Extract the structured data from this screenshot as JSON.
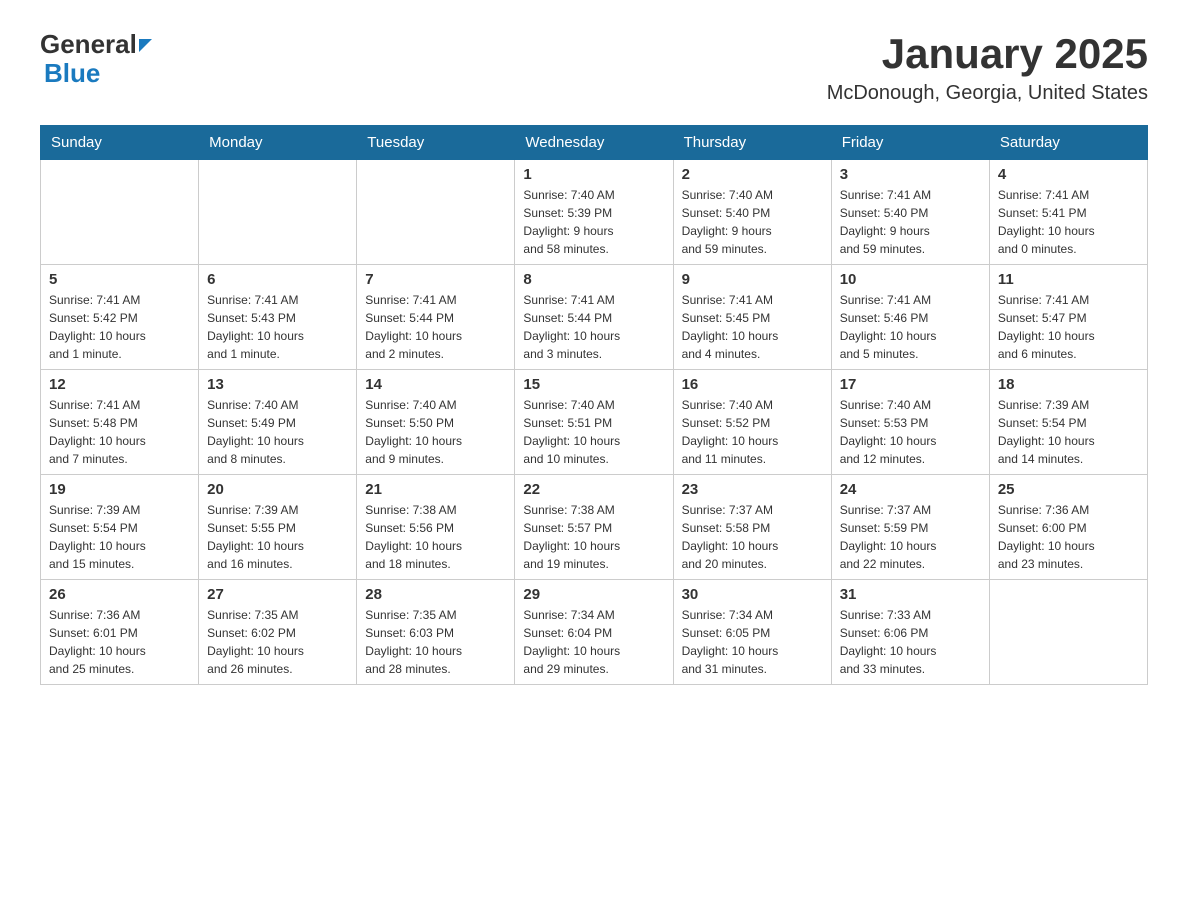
{
  "header": {
    "logo_general": "General",
    "logo_blue": "Blue",
    "month_year": "January 2025",
    "location": "McDonough, Georgia, United States"
  },
  "weekdays": [
    "Sunday",
    "Monday",
    "Tuesday",
    "Wednesday",
    "Thursday",
    "Friday",
    "Saturday"
  ],
  "weeks": [
    [
      {
        "day": "",
        "info": ""
      },
      {
        "day": "",
        "info": ""
      },
      {
        "day": "",
        "info": ""
      },
      {
        "day": "1",
        "info": "Sunrise: 7:40 AM\nSunset: 5:39 PM\nDaylight: 9 hours\nand 58 minutes."
      },
      {
        "day": "2",
        "info": "Sunrise: 7:40 AM\nSunset: 5:40 PM\nDaylight: 9 hours\nand 59 minutes."
      },
      {
        "day": "3",
        "info": "Sunrise: 7:41 AM\nSunset: 5:40 PM\nDaylight: 9 hours\nand 59 minutes."
      },
      {
        "day": "4",
        "info": "Sunrise: 7:41 AM\nSunset: 5:41 PM\nDaylight: 10 hours\nand 0 minutes."
      }
    ],
    [
      {
        "day": "5",
        "info": "Sunrise: 7:41 AM\nSunset: 5:42 PM\nDaylight: 10 hours\nand 1 minute."
      },
      {
        "day": "6",
        "info": "Sunrise: 7:41 AM\nSunset: 5:43 PM\nDaylight: 10 hours\nand 1 minute."
      },
      {
        "day": "7",
        "info": "Sunrise: 7:41 AM\nSunset: 5:44 PM\nDaylight: 10 hours\nand 2 minutes."
      },
      {
        "day": "8",
        "info": "Sunrise: 7:41 AM\nSunset: 5:44 PM\nDaylight: 10 hours\nand 3 minutes."
      },
      {
        "day": "9",
        "info": "Sunrise: 7:41 AM\nSunset: 5:45 PM\nDaylight: 10 hours\nand 4 minutes."
      },
      {
        "day": "10",
        "info": "Sunrise: 7:41 AM\nSunset: 5:46 PM\nDaylight: 10 hours\nand 5 minutes."
      },
      {
        "day": "11",
        "info": "Sunrise: 7:41 AM\nSunset: 5:47 PM\nDaylight: 10 hours\nand 6 minutes."
      }
    ],
    [
      {
        "day": "12",
        "info": "Sunrise: 7:41 AM\nSunset: 5:48 PM\nDaylight: 10 hours\nand 7 minutes."
      },
      {
        "day": "13",
        "info": "Sunrise: 7:40 AM\nSunset: 5:49 PM\nDaylight: 10 hours\nand 8 minutes."
      },
      {
        "day": "14",
        "info": "Sunrise: 7:40 AM\nSunset: 5:50 PM\nDaylight: 10 hours\nand 9 minutes."
      },
      {
        "day": "15",
        "info": "Sunrise: 7:40 AM\nSunset: 5:51 PM\nDaylight: 10 hours\nand 10 minutes."
      },
      {
        "day": "16",
        "info": "Sunrise: 7:40 AM\nSunset: 5:52 PM\nDaylight: 10 hours\nand 11 minutes."
      },
      {
        "day": "17",
        "info": "Sunrise: 7:40 AM\nSunset: 5:53 PM\nDaylight: 10 hours\nand 12 minutes."
      },
      {
        "day": "18",
        "info": "Sunrise: 7:39 AM\nSunset: 5:54 PM\nDaylight: 10 hours\nand 14 minutes."
      }
    ],
    [
      {
        "day": "19",
        "info": "Sunrise: 7:39 AM\nSunset: 5:54 PM\nDaylight: 10 hours\nand 15 minutes."
      },
      {
        "day": "20",
        "info": "Sunrise: 7:39 AM\nSunset: 5:55 PM\nDaylight: 10 hours\nand 16 minutes."
      },
      {
        "day": "21",
        "info": "Sunrise: 7:38 AM\nSunset: 5:56 PM\nDaylight: 10 hours\nand 18 minutes."
      },
      {
        "day": "22",
        "info": "Sunrise: 7:38 AM\nSunset: 5:57 PM\nDaylight: 10 hours\nand 19 minutes."
      },
      {
        "day": "23",
        "info": "Sunrise: 7:37 AM\nSunset: 5:58 PM\nDaylight: 10 hours\nand 20 minutes."
      },
      {
        "day": "24",
        "info": "Sunrise: 7:37 AM\nSunset: 5:59 PM\nDaylight: 10 hours\nand 22 minutes."
      },
      {
        "day": "25",
        "info": "Sunrise: 7:36 AM\nSunset: 6:00 PM\nDaylight: 10 hours\nand 23 minutes."
      }
    ],
    [
      {
        "day": "26",
        "info": "Sunrise: 7:36 AM\nSunset: 6:01 PM\nDaylight: 10 hours\nand 25 minutes."
      },
      {
        "day": "27",
        "info": "Sunrise: 7:35 AM\nSunset: 6:02 PM\nDaylight: 10 hours\nand 26 minutes."
      },
      {
        "day": "28",
        "info": "Sunrise: 7:35 AM\nSunset: 6:03 PM\nDaylight: 10 hours\nand 28 minutes."
      },
      {
        "day": "29",
        "info": "Sunrise: 7:34 AM\nSunset: 6:04 PM\nDaylight: 10 hours\nand 29 minutes."
      },
      {
        "day": "30",
        "info": "Sunrise: 7:34 AM\nSunset: 6:05 PM\nDaylight: 10 hours\nand 31 minutes."
      },
      {
        "day": "31",
        "info": "Sunrise: 7:33 AM\nSunset: 6:06 PM\nDaylight: 10 hours\nand 33 minutes."
      },
      {
        "day": "",
        "info": ""
      }
    ]
  ]
}
